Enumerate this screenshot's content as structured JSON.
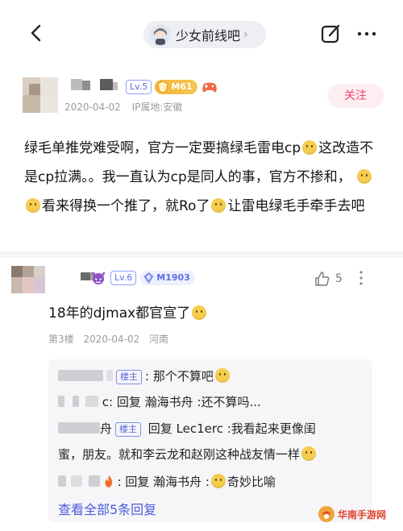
{
  "header": {
    "forum_name": "少女前线吧",
    "forum_chevron": "›"
  },
  "op": {
    "level": "Lv.5",
    "member_badge": "M61",
    "date": "2020-04-02",
    "ip_location": "IP属地:安徽",
    "follow_label": "关注",
    "body_1": "绿毛单推党难受啊，官方一定要搞绿毛雷电cp",
    "body_2": "这改造不是cp拉满。。我一直认为cp是同人的事，官方不掺和，",
    "body_3": "看来得换一个推了，就Ro了",
    "body_4": "让雷电绿毛手牵手去吧"
  },
  "reply": {
    "level": "Lv.6",
    "member_badge": "M1903",
    "like_count": "5",
    "text": "18年的djmax都官宣了",
    "floor": "第3楼",
    "date": "2020-04-02",
    "location": "河南"
  },
  "sub_replies": {
    "host_tag": "楼主",
    "r1_text": ": 那个不算吧",
    "r2_prefix": "c: 回复",
    "r2_target": "瀚海书舟",
    "r2_text": ":还不算吗...",
    "r3_prefix_char": "舟",
    "r3_text": "回复 Lec1erc :我看起来更像闺",
    "r3_text_2": "蜜，朋友。就和李云龙和赵刚这种战友情一样",
    "r4_text": ": 回复 瀚海书舟 :",
    "r4_text_2": "奇妙比喻",
    "view_all": "查看全部5条回复"
  },
  "watermark": {
    "text": "华南手游网"
  },
  "colors": {
    "accent_blue": "#4a5bdc",
    "follow_pink": "#f0446b",
    "member_gold": "#f4b43a"
  },
  "icons": [
    "back-arrow-icon",
    "edit-icon",
    "more-icon",
    "thumbs-up-icon",
    "gamepad-icon",
    "devil-icon",
    "diamond-icon",
    "fire-icon"
  ]
}
